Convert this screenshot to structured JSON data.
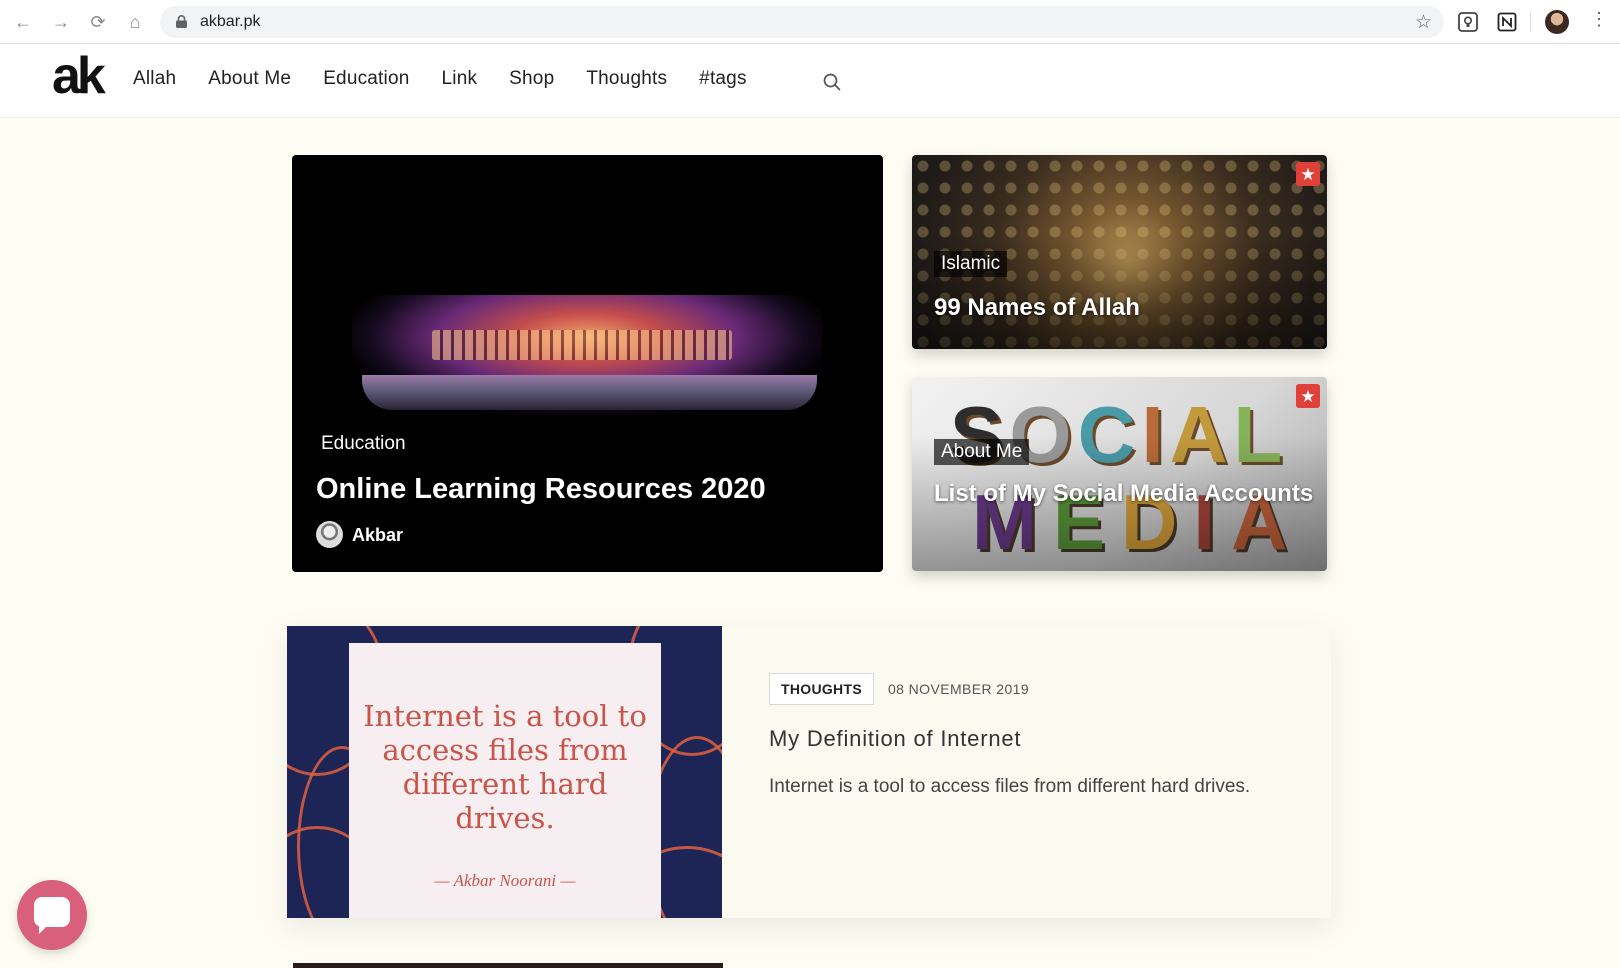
{
  "browser": {
    "url": "akbar.pk"
  },
  "site": {
    "logo": "ak",
    "menu": [
      "Allah",
      "About Me",
      "Education",
      "Link",
      "Shop",
      "Thoughts",
      "#tags"
    ]
  },
  "hero": {
    "category": "Education",
    "title": "Online Learning Resources 2020",
    "author": "Akbar"
  },
  "side_cards": [
    {
      "category": "Islamic",
      "title": "99 Names of Allah",
      "featured_icon": "star-icon"
    },
    {
      "category": "About Me",
      "title": "List of My Social Media Accounts",
      "featured_icon": "star-icon"
    }
  ],
  "post": {
    "tag": "THOUGHTS",
    "date": "08 NOVEMBER 2019",
    "title": "My Definition of Internet",
    "excerpt": "Internet is a tool to access files from different hard drives.",
    "image_quote": "Internet is a tool to access files from different hard drives.",
    "image_signature": "— Akbar Noorani —"
  },
  "colors": {
    "accent": "#e0403a",
    "chat": "#d9607a",
    "page_bg": "#fdfdf3"
  }
}
